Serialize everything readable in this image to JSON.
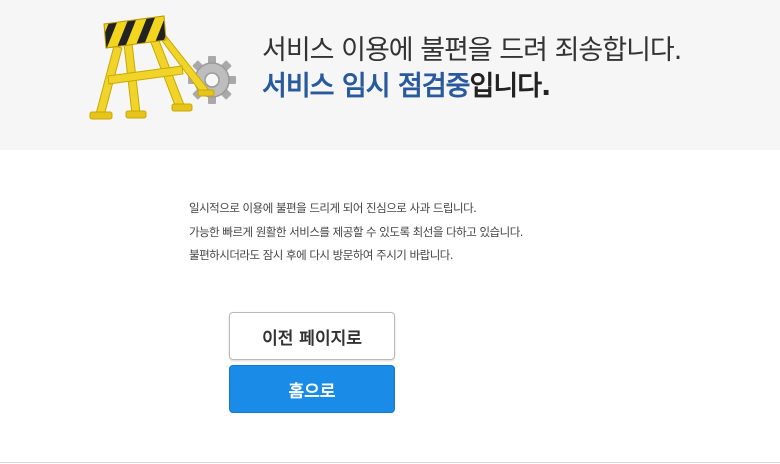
{
  "banner": {
    "title_line1": "서비스 이용에 불편을 드려 죄송합니다.",
    "title_line2_accent": "서비스 임시 점검중",
    "title_line2_rest": "입니다."
  },
  "message": {
    "lines": [
      "일시적으로 이용에 불편을 드리게 되어 진심으로 사과 드립니다.",
      "가능한 빠르게 원활한 서비스를 제공할 수 있도록 최선을 다하고 있습니다.",
      "불편하시더라도 잠시 후에 다시 방문하여 주시기 바랍니다."
    ]
  },
  "buttons": {
    "prev_label": "이전 페이지로",
    "home_label": "홈으로"
  },
  "colors": {
    "accent": "#2a5a9e",
    "home_button": "#1a8ce8",
    "banner_bg": "#f6f6f6"
  },
  "icons": [
    "construction-barrier-icon",
    "gear-icon"
  ]
}
